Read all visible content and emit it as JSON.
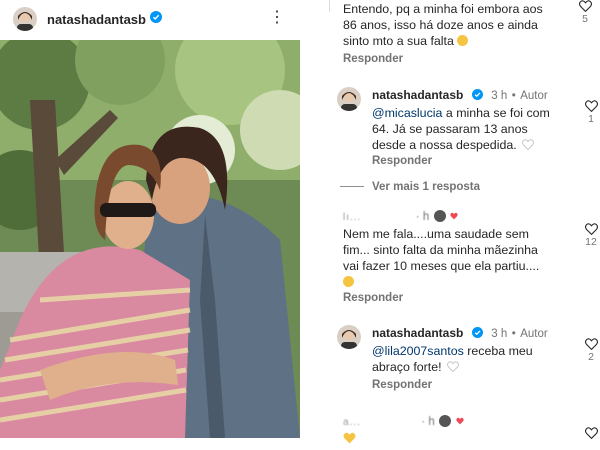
{
  "post": {
    "username": "natashadantasb",
    "more_label": "⋮"
  },
  "comments": {
    "top_comment": {
      "line1": "Entendo, pq a minha foi embora aos",
      "line2": "86 anos, isso há doze anos e ainda",
      "line3": "sinto mto a sua falta",
      "reply": "Responder",
      "likes": "5"
    },
    "reply1": {
      "username": "natashadantasb",
      "time": "3 h",
      "author_label": "Autor",
      "mention": "@micaslucia",
      "line1_rest": " a minha se foi com",
      "line2": "64. Já se passaram 13 anos",
      "line3": "desde a nossa despedida.",
      "reply": "Responder",
      "likes": "1"
    },
    "view_more": "Ver mais 1 resposta",
    "comment2": {
      "username": "lı...",
      "line1": "Nem me fala....uma saudade sem",
      "line2": "fim... sinto falta da minha mãezinha",
      "line3": "vai fazer 10 meses que ela partiu....",
      "reply": "Responder",
      "likes": "12"
    },
    "reply2": {
      "username": "natashadantasb",
      "time": "3 h",
      "author_label": "Autor",
      "mention": "@lila2007santos",
      "line1_rest": " receba meu",
      "line2": "abraço forte!",
      "reply": "Responder",
      "likes": "2"
    },
    "comment3": {
      "username": "a...",
      "likes": ""
    }
  },
  "colors": {
    "verified": "#0095f6",
    "text": "#262626",
    "secondary": "#737373",
    "mention": "#00376b"
  }
}
